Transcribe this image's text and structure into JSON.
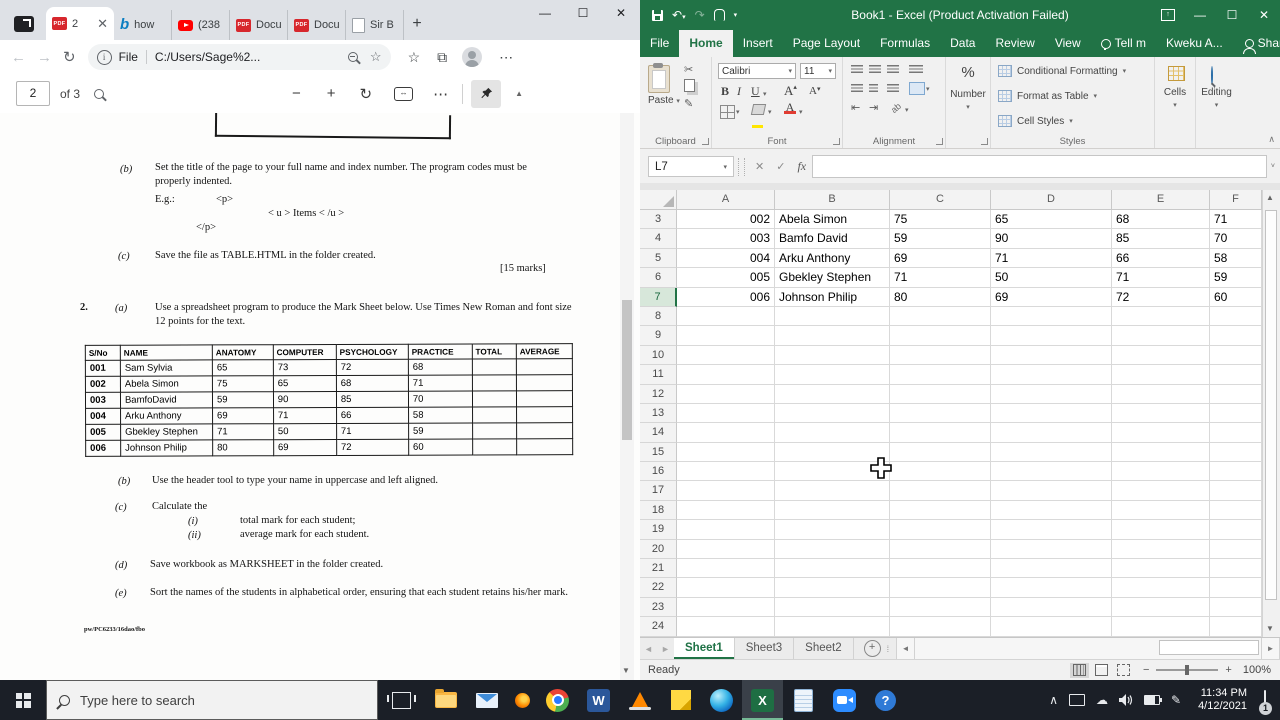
{
  "browser": {
    "tabs": [
      {
        "label": "2",
        "icon": "pdf",
        "active": true
      },
      {
        "label": "how",
        "icon": "bing"
      },
      {
        "label": "(238",
        "icon": "youtube"
      },
      {
        "label": "Docu",
        "icon": "pdf"
      },
      {
        "label": "Docu",
        "icon": "pdf"
      },
      {
        "label": "Sir B",
        "icon": "doc"
      }
    ],
    "new_tab": "+",
    "window_controls": {
      "minimize": "—",
      "maximize": "☐",
      "close": "✕"
    },
    "address": {
      "prefix": "File",
      "url": "C:/Users/Sage%2..."
    },
    "pdf_toolbar": {
      "page_value": "2",
      "page_count": "of 3"
    }
  },
  "document": {
    "item_b1": {
      "label": "(b)",
      "text": "Set the title of the page to your full name and index number. The program codes must be properly indented.",
      "eg_label": "E.g.:",
      "code1": "<p>",
      "code2": "< u > Items < /u >",
      "code3": "</p>"
    },
    "item_c1": {
      "label": "(c)",
      "text": "Save the file as TABLE.HTML in the folder created.",
      "marks": "[15 marks]"
    },
    "q2": {
      "number": "2.",
      "label": "(a)",
      "text": "Use a spreadsheet program to produce the Mark Sheet below. Use Times New Roman and font size 12 points for the text."
    },
    "table": {
      "headers": [
        "S/No",
        "NAME",
        "ANATOMY",
        "COMPUTER",
        "PSYCHOLOGY",
        "PRACTICE",
        "TOTAL",
        "AVERAGE"
      ],
      "rows": [
        [
          "001",
          "Sam Sylvia",
          "65",
          "73",
          "72",
          "68",
          "",
          ""
        ],
        [
          "002",
          "Abela Simon",
          "75",
          "65",
          "68",
          "71",
          "",
          ""
        ],
        [
          "003",
          "BamfoDavid",
          "59",
          "90",
          "85",
          "70",
          "",
          ""
        ],
        [
          "004",
          "Arku Anthony",
          "69",
          "71",
          "66",
          "58",
          "",
          ""
        ],
        [
          "005",
          "Gbekley Stephen",
          "71",
          "50",
          "71",
          "59",
          "",
          ""
        ],
        [
          "006",
          "Johnson Philip",
          "80",
          "69",
          "72",
          "60",
          "",
          ""
        ]
      ]
    },
    "item_b2": {
      "label": "(b)",
      "text": "Use the header tool to type your name in uppercase and left aligned."
    },
    "item_c2": {
      "label": "(c)",
      "text": "Calculate the",
      "sub1_label": "(i)",
      "sub1_text": "total mark for each student;",
      "sub2_label": "(ii)",
      "sub2_text": "average mark for each student."
    },
    "item_d": {
      "label": "(d)",
      "text": "Save workbook as MARKSHEET in the folder created."
    },
    "item_e": {
      "label": "(e)",
      "text": "Sort the names of the students in alphabetical order, ensuring that each student retains his/her mark."
    },
    "footer": "pw/PC6233/16dao/fbo"
  },
  "excel": {
    "title": "Book1 - Excel (Product Activation Failed)",
    "ribbon_tabs": [
      "File",
      "Home",
      "Insert",
      "Page Layout",
      "Formulas",
      "Data",
      "Review",
      "View"
    ],
    "active_ribbon_tab": "Home",
    "tellme": "Tell m",
    "user": "Kweku A...",
    "share": "Share",
    "font_name": "Calibri",
    "font_size": "11",
    "glyphs": {
      "bold": "B",
      "italic": "I",
      "underline": "U",
      "percent": "%",
      "fx": "fx",
      "grow": "A",
      "shrink": "A"
    },
    "labels": {
      "paste": "Paste",
      "clipboard": "Clipboard",
      "font": "Font",
      "alignment": "Alignment",
      "number": "Number",
      "styles": "Styles",
      "cells": "Cells",
      "editing": "Editing",
      "conditional": "Conditional Formatting",
      "format_table": "Format as Table",
      "cell_styles": "Cell Styles"
    },
    "name_box": "L7",
    "formula_value": "",
    "columns": [
      "A",
      "B",
      "C",
      "D",
      "E",
      "F"
    ],
    "first_row": 3,
    "last_row": 24,
    "active_row": 7,
    "cells": {
      "3": [
        "002",
        "Abela Simon",
        "75",
        "65",
        "68",
        "71"
      ],
      "4": [
        "003",
        "Bamfo David",
        "59",
        "90",
        "85",
        "70"
      ],
      "5": [
        "004",
        "Arku Anthony",
        "69",
        "71",
        "66",
        "58"
      ],
      "6": [
        "005",
        "Gbekley Stephen",
        "71",
        "50",
        "71",
        "59"
      ],
      "7": [
        "006",
        "Johnson Philip",
        "80",
        "69",
        "72",
        "60"
      ]
    },
    "sheets": [
      {
        "name": "Sheet1",
        "active": true
      },
      {
        "name": "Sheet3",
        "active": false
      },
      {
        "name": "Sheet2",
        "active": false
      }
    ],
    "status": "Ready",
    "zoom": "100%"
  },
  "taskbar": {
    "search_placeholder": "Type here to search",
    "time": "11:34 PM",
    "date": "4/12/2021",
    "badge": "1"
  },
  "colors": {
    "excel_green": "#217346",
    "taskbar": "#1b1f27",
    "pdf_red": "#d7272d"
  }
}
